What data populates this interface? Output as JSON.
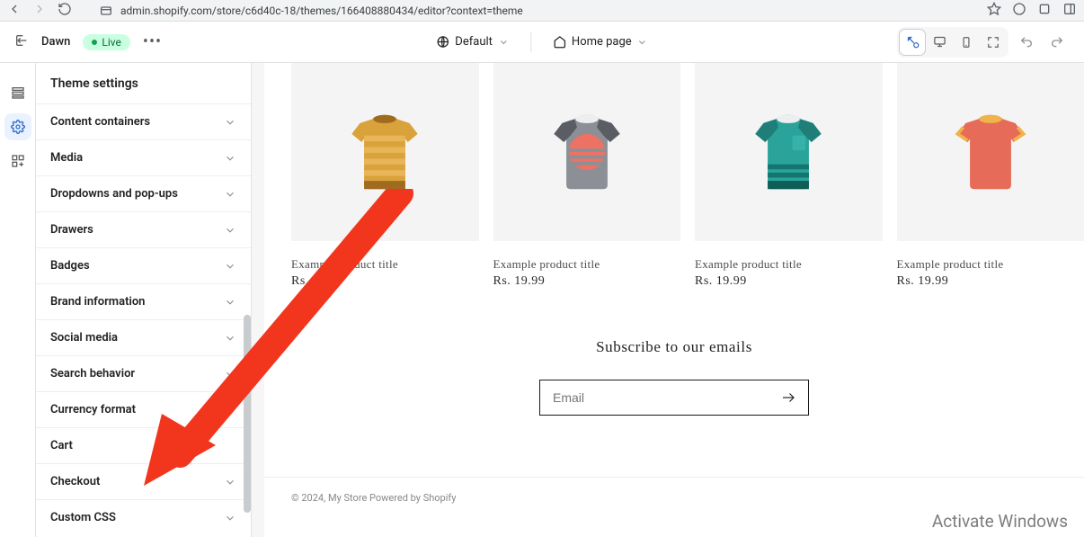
{
  "browser": {
    "url": "admin.shopify.com/store/c6d40c-18/themes/166408880434/editor?context=theme"
  },
  "toolbar": {
    "theme_name": "Dawn",
    "status": "Live",
    "locale_label": "Default",
    "page_label": "Home page"
  },
  "sidebar": {
    "header": "Theme settings",
    "items": [
      {
        "label": "Content containers",
        "expandable": true
      },
      {
        "label": "Media",
        "expandable": true
      },
      {
        "label": "Dropdowns and pop-ups",
        "expandable": true
      },
      {
        "label": "Drawers",
        "expandable": true
      },
      {
        "label": "Badges",
        "expandable": true
      },
      {
        "label": "Brand information",
        "expandable": true
      },
      {
        "label": "Social media",
        "expandable": true
      },
      {
        "label": "Search behavior",
        "expandable": true
      },
      {
        "label": "Currency format",
        "expandable": true
      },
      {
        "label": "Cart",
        "expandable": false
      },
      {
        "label": "Checkout",
        "expandable": true
      },
      {
        "label": "Custom CSS",
        "expandable": true
      }
    ]
  },
  "preview": {
    "products": [
      {
        "title": "Example product title",
        "price": "Rs. 19.99"
      },
      {
        "title": "Example product title",
        "price": "Rs. 19.99"
      },
      {
        "title": "Example product title",
        "price": "Rs. 19.99"
      },
      {
        "title": "Example product title",
        "price": "Rs. 19.99"
      }
    ],
    "newsletter": {
      "title": "Subscribe to our emails",
      "placeholder": "Email"
    },
    "footer": {
      "copyright": "© 2024, My Store Powered by Shopify"
    },
    "watermark": {
      "line1": "Activate Windows"
    }
  }
}
